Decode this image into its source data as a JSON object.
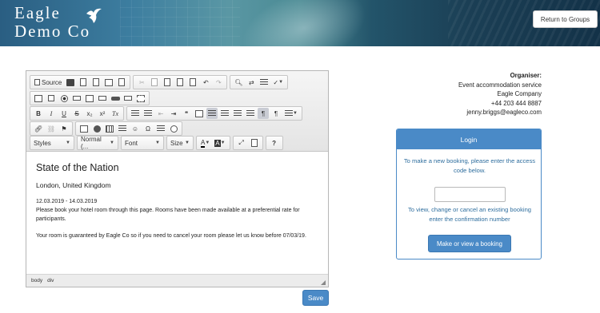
{
  "header": {
    "logo_line1": "Eagle",
    "logo_line2": "Demo Co",
    "return_button": "Return to Groups"
  },
  "editor": {
    "toolbar": {
      "source_label": "Source",
      "styles_combo": "Styles",
      "format_combo": "Normal (...",
      "font_combo": "Font",
      "size_combo": "Size",
      "text_color": "A",
      "bg_color": "A",
      "help": "?",
      "bold": "B",
      "italic": "I",
      "underline": "U",
      "strike": "S",
      "subscript": "x₂",
      "superscript": "x²",
      "remove_format": "Tx"
    },
    "content": {
      "title": "State of the Nation",
      "location": "London, United Kingdom",
      "dates": "12.03.2019 - 14.03.2019",
      "paragraph1": "Please book your hotel room through this page. Rooms have been made available at a preferential rate for participants.",
      "paragraph2": "Your room is guaranteed by Eagle Co so if you need to cancel your room please let us know before 07/03/19."
    },
    "statusbar": {
      "path1": "body",
      "path2": "div"
    }
  },
  "save_button": "Save",
  "organiser": {
    "label": "Organiser:",
    "service": "Event accommodation service",
    "company": "Eagle Company",
    "phone": "+44 203 444 8887",
    "email": "jenny.briggs@eagleco.com"
  },
  "login": {
    "title": "Login",
    "instruction": "To make a new booking, please enter the access code below.",
    "code_value": "",
    "secondary_instruction": "To view, change or cancel an existing booking enter the confirmation number",
    "booking_button": "Make or view a booking"
  },
  "colors": {
    "primary": "#4a8ac7",
    "link_text": "#2f6e9e",
    "header_dark": "#1b3f55"
  }
}
